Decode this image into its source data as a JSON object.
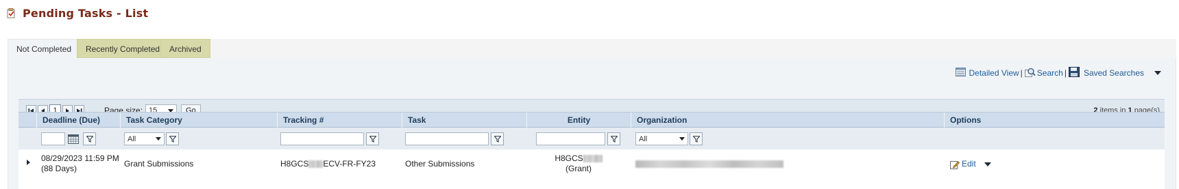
{
  "page": {
    "title": "Pending Tasks - List"
  },
  "tabs": [
    {
      "label": "Not Completed",
      "active": true
    },
    {
      "label": "Recently Completed",
      "active": false
    },
    {
      "label": "Archived",
      "active": false
    }
  ],
  "toolbar": {
    "detailed_view": "Detailed View",
    "separator": "|",
    "search": "Search",
    "saved_searches": "Saved Searches"
  },
  "pager": {
    "current_page": "1",
    "page_size_label": "Page size:",
    "page_size_value": "15",
    "go_label": "Go",
    "items_count": "2",
    "items_text_mid": " items in ",
    "pages_count": "1",
    "items_text_end": " page(s)"
  },
  "columns": {
    "deadline": "Deadline (Due)",
    "task_category": "Task Category",
    "tracking": "Tracking #",
    "task": "Task",
    "entity": "Entity",
    "organization": "Organization",
    "options": "Options"
  },
  "filters": {
    "task_category": "All",
    "organization": "All"
  },
  "rows": [
    {
      "deadline_date": "08/29/2023 11:59 PM",
      "deadline_days": "(88 Days)",
      "task_category": "Grant Submissions",
      "tracking_prefix": "H8GCS",
      "tracking_suffix": "ECV-FR-FY23",
      "task": "Other Submissions",
      "entity_prefix": "H8GCS",
      "entity_type": "(Grant)",
      "options_edit": "Edit"
    }
  ],
  "colors": {
    "title": "#7a2a1a",
    "link": "#1f5a96",
    "header_bg": "#cfdceb",
    "header_text": "#1d3c5c",
    "inactive_tab_bg": "#d8d9a9"
  }
}
